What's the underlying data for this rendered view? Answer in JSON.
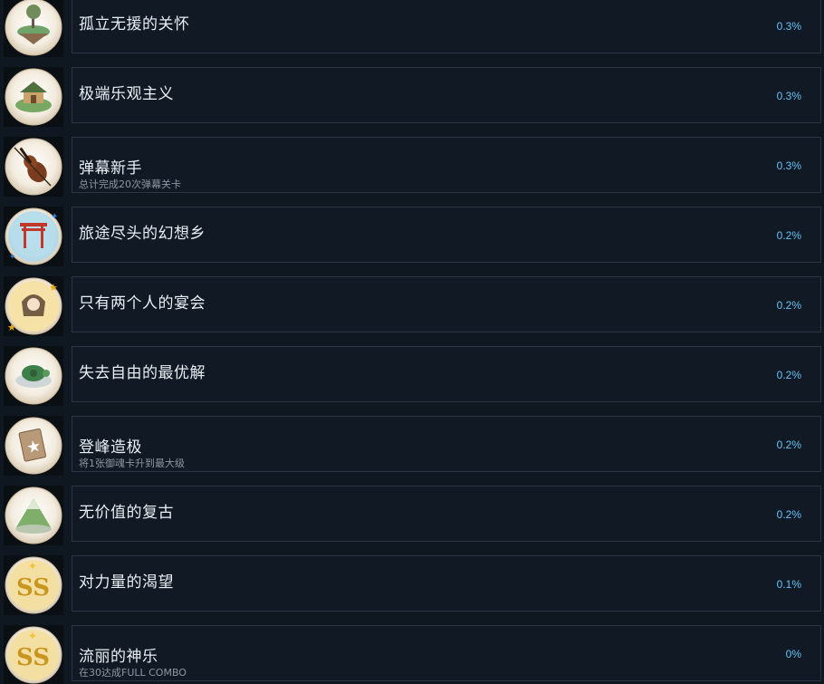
{
  "achievements": [
    {
      "title": "孤立无援的关怀",
      "desc": "",
      "percent": "0.3%",
      "icon": "floating-island-icon"
    },
    {
      "title": "极端乐观主义",
      "desc": "",
      "percent": "0.3%",
      "icon": "shrine-house-icon"
    },
    {
      "title": "弹幕新手",
      "desc": "总计完成20次弹幕关卡",
      "percent": "0.3%",
      "icon": "violin-icon"
    },
    {
      "title": "旅途尽头的幻想乡",
      "desc": "",
      "percent": "0.2%",
      "icon": "torii-gate-icon"
    },
    {
      "title": "只有两个人的宴会",
      "desc": "",
      "percent": "0.2%",
      "icon": "character-portrait-icon"
    },
    {
      "title": "失去自由的最优解",
      "desc": "",
      "percent": "0.2%",
      "icon": "turtle-icon"
    },
    {
      "title": "登峰造极",
      "desc": "将1张御魂卡升到最大级",
      "percent": "0.2%",
      "icon": "star-card-icon"
    },
    {
      "title": "无价值的复古",
      "desc": "",
      "percent": "0.2%",
      "icon": "mountain-icon"
    },
    {
      "title": "对力量的渴望",
      "desc": "",
      "percent": "0.1%",
      "icon": "ss-rank-icon"
    },
    {
      "title": "流丽的神乐",
      "desc": "在30达成FULL COMBO",
      "percent": "0%",
      "icon": "ss-rank-icon"
    }
  ],
  "colors": {
    "background": "#0f1720",
    "panel": "#111a24",
    "panel_border": "#2a3644",
    "title": "#e8eef4",
    "desc": "#8d97a2",
    "percent": "#66c0f4"
  }
}
